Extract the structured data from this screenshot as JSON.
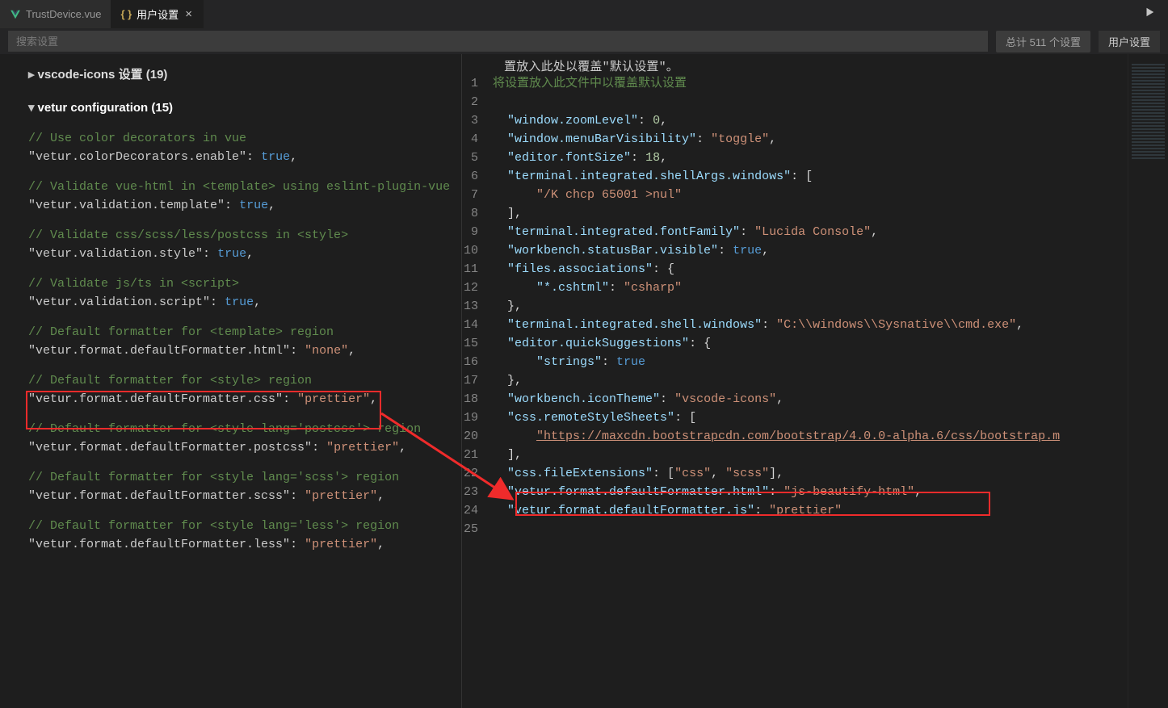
{
  "tabs": {
    "tab1": "TrustDevice.vue",
    "tab2": "用户设置"
  },
  "search": {
    "placeholder": "搜索设置",
    "summary": "总计 511 个设置",
    "userSettings": "用户设置"
  },
  "section_vscode_icons": "vscode-icons 设置 (19)",
  "section_vetur": "vetur configuration (15)",
  "left_settings": [
    {
      "comment": "// Use color decorators in vue",
      "key": "\"vetur.colorDecorators.enable\"",
      "val": "true",
      "valType": "bool"
    },
    {
      "comment": "// Validate vue-html in <template> using eslint-plugin-vue",
      "key": "\"vetur.validation.template\"",
      "val": "true",
      "valType": "bool"
    },
    {
      "comment": "// Validate css/scss/less/postcss in <style>",
      "key": "\"vetur.validation.style\"",
      "val": "true",
      "valType": "bool"
    },
    {
      "comment": "// Validate js/ts in <script>",
      "key": "\"vetur.validation.script\"",
      "val": "true",
      "valType": "bool"
    },
    {
      "comment": "// Default formatter for <template> region",
      "key": "\"vetur.format.defaultFormatter.html\"",
      "val": "\"none\"",
      "valType": "str"
    },
    {
      "comment": "// Default formatter for <style> region",
      "key": "\"vetur.format.defaultFormatter.css\"",
      "val": "\"prettier\"",
      "valType": "str"
    },
    {
      "comment": "// Default formatter for <style lang='postcss'> region",
      "key": "\"vetur.format.defaultFormatter.postcss\"",
      "val": "\"prettier\"",
      "valType": "str"
    },
    {
      "comment": "// Default formatter for <style lang='scss'> region",
      "key": "\"vetur.format.defaultFormatter.scss\"",
      "val": "\"prettier\"",
      "valType": "str"
    },
    {
      "comment": "// Default formatter for <style lang='less'> region",
      "key": "\"vetur.format.defaultFormatter.less\"",
      "val": "\"prettier\"",
      "valType": "str"
    }
  ],
  "right_banner": "置放入此处以覆盖\"默认设置\"。",
  "right_lines": {
    "l1": "将设置放入此文件中以覆盖默认设置",
    "l3a": "\"window.zoomLevel\"",
    "l3v": "0",
    "l4a": "\"window.menuBarVisibility\"",
    "l4v": "\"toggle\"",
    "l5a": "\"editor.fontSize\"",
    "l5v": "18",
    "l6a": "\"terminal.integrated.shellArgs.windows\"",
    "l7v": "\"/K chcp 65001 >nul\"",
    "l9a": "\"terminal.integrated.fontFamily\"",
    "l9v": "\"Lucida Console\"",
    "l10a": "\"workbench.statusBar.visible\"",
    "l10v": "true",
    "l11a": "\"files.associations\"",
    "l12a": "\"*.cshtml\"",
    "l12v": "\"csharp\"",
    "l14a": "\"terminal.integrated.shell.windows\"",
    "l14v": "\"C:\\\\windows\\\\Sysnative\\\\cmd.exe\"",
    "l15a": "\"editor.quickSuggestions\"",
    "l16a": "\"strings\"",
    "l16v": "true",
    "l18a": "\"workbench.iconTheme\"",
    "l18v": "\"vscode-icons\"",
    "l19a": "\"css.remoteStyleSheets\"",
    "l20v": "\"https://maxcdn.bootstrapcdn.com/bootstrap/4.0.0-alpha.6/css/bootstrap.m",
    "l22a": "\"css.fileExtensions\"",
    "l22v1": "\"css\"",
    "l22v2": "\"scss\"",
    "l23a": "\"vetur.format.defaultFormatter.html\"",
    "l23v": "\"js-beautify-html\"",
    "l24a": "\"vetur.format.defaultFormatter.js\"",
    "l24v": "\"prettier\""
  },
  "line_numbers": [
    "1",
    "2",
    "3",
    "4",
    "5",
    "6",
    "7",
    "8",
    "9",
    "10",
    "11",
    "12",
    "13",
    "14",
    "15",
    "16",
    "17",
    "18",
    "19",
    "20",
    "21",
    "22",
    "23",
    "24",
    "25"
  ]
}
